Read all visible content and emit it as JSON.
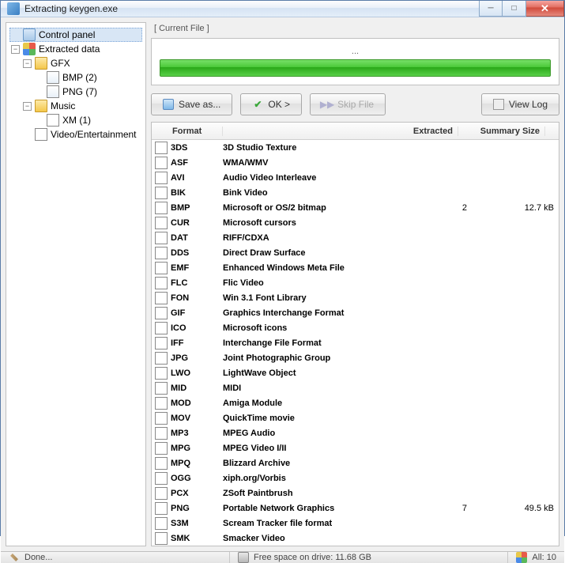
{
  "window": {
    "title": "Extracting keygen.exe"
  },
  "tree": {
    "items": [
      {
        "label": "Control panel",
        "depth": 0,
        "toggle": "",
        "icon": "ic-cp",
        "selected": true
      },
      {
        "label": "Extracted data",
        "depth": 0,
        "toggle": "▾",
        "icon": "ic-ext"
      },
      {
        "label": "GFX",
        "depth": 1,
        "toggle": "▾",
        "icon": "ic-fold"
      },
      {
        "label": "BMP (2)",
        "depth": 2,
        "toggle": "",
        "icon": "ic-img"
      },
      {
        "label": "PNG (7)",
        "depth": 2,
        "toggle": "",
        "icon": "ic-img"
      },
      {
        "label": "Music",
        "depth": 1,
        "toggle": "▾",
        "icon": "ic-fold"
      },
      {
        "label": "XM (1)",
        "depth": 2,
        "toggle": "",
        "icon": "ic-note"
      },
      {
        "label": "Video/Entertainment",
        "depth": 1,
        "toggle": "",
        "icon": "ic-vid"
      }
    ]
  },
  "main": {
    "current_label": "[ Current File ]",
    "progress_caption": "...",
    "buttons": {
      "save": "Save as...",
      "ok": "OK >",
      "skip": "Skip File",
      "viewlog": "View Log"
    }
  },
  "grid": {
    "headers": {
      "fmt": "Format",
      "desc": "",
      "ext": "Extracted",
      "size": "Summary Size"
    },
    "rows": [
      {
        "fmt": "3DS",
        "desc": "3D Studio Texture",
        "ext": "",
        "size": "",
        "ic": "gi-green"
      },
      {
        "fmt": "ASF",
        "desc": "WMA/WMV",
        "ext": "",
        "size": "",
        "ic": "gi-orange"
      },
      {
        "fmt": "AVI",
        "desc": "Audio Video Interleave",
        "ext": "",
        "size": "",
        "ic": "gi-blue"
      },
      {
        "fmt": "BIK",
        "desc": "Bink Video",
        "ext": "",
        "size": "",
        "ic": "gi-purple"
      },
      {
        "fmt": "BMP",
        "desc": "Microsoft or OS/2 bitmap",
        "ext": "2",
        "size": "12.7 kB",
        "ic": "gi-white"
      },
      {
        "fmt": "CUR",
        "desc": "Microsoft cursors",
        "ext": "",
        "size": "",
        "ic": "gi-white"
      },
      {
        "fmt": "DAT",
        "desc": "RIFF/CDXA",
        "ext": "",
        "size": "",
        "ic": "gi-yellow"
      },
      {
        "fmt": "DDS",
        "desc": "Direct Draw Surface",
        "ext": "",
        "size": "",
        "ic": "gi-blue"
      },
      {
        "fmt": "EMF",
        "desc": "Enhanced Windows Meta File",
        "ext": "",
        "size": "",
        "ic": "gi-white"
      },
      {
        "fmt": "FLC",
        "desc": "Flic Video",
        "ext": "",
        "size": "",
        "ic": "gi-red"
      },
      {
        "fmt": "FON",
        "desc": "Win 3.1 Font Library",
        "ext": "",
        "size": "",
        "ic": "gi-red"
      },
      {
        "fmt": "GIF",
        "desc": "Graphics Interchange Format",
        "ext": "",
        "size": "",
        "ic": "gi-white"
      },
      {
        "fmt": "ICO",
        "desc": "Microsoft icons",
        "ext": "",
        "size": "",
        "ic": "gi-orange"
      },
      {
        "fmt": "IFF",
        "desc": "Interchange File Format",
        "ext": "",
        "size": "",
        "ic": "gi-cyan"
      },
      {
        "fmt": "JPG",
        "desc": "Joint Photographic Group",
        "ext": "",
        "size": "",
        "ic": "gi-white"
      },
      {
        "fmt": "LWO",
        "desc": "LightWave Object",
        "ext": "",
        "size": "",
        "ic": "gi-orange"
      },
      {
        "fmt": "MID",
        "desc": "MIDI",
        "ext": "",
        "size": "",
        "ic": "gi-blue"
      },
      {
        "fmt": "MOD",
        "desc": "Amiga Module",
        "ext": "",
        "size": "",
        "ic": "gi-blue"
      },
      {
        "fmt": "MOV",
        "desc": "QuickTime movie",
        "ext": "",
        "size": "",
        "ic": "gi-cyan"
      },
      {
        "fmt": "MP3",
        "desc": "MPEG Audio",
        "ext": "",
        "size": "",
        "ic": "gi-blue"
      },
      {
        "fmt": "MPG",
        "desc": "MPEG Video I/II",
        "ext": "",
        "size": "",
        "ic": "gi-blue"
      },
      {
        "fmt": "MPQ",
        "desc": "Blizzard Archive",
        "ext": "",
        "size": "",
        "ic": "gi-yellow"
      },
      {
        "fmt": "OGG",
        "desc": "xiph.org/Vorbis",
        "ext": "",
        "size": "",
        "ic": "gi-white"
      },
      {
        "fmt": "PCX",
        "desc": "ZSoft Paintbrush",
        "ext": "",
        "size": "",
        "ic": "gi-green"
      },
      {
        "fmt": "PNG",
        "desc": "Portable Network Graphics",
        "ext": "7",
        "size": "49.5 kB",
        "ic": "gi-blue"
      },
      {
        "fmt": "S3M",
        "desc": "Scream Tracker file format",
        "ext": "",
        "size": "",
        "ic": "gi-blue"
      },
      {
        "fmt": "SMK",
        "desc": "Smacker Video",
        "ext": "",
        "size": "",
        "ic": "gi-white"
      }
    ]
  },
  "status": {
    "done": "Done...",
    "freespace": "Free space on drive: 11.68 GB",
    "all": "All: 10"
  }
}
